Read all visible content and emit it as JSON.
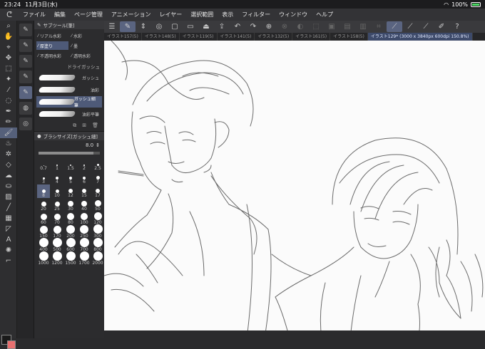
{
  "status": {
    "time": "23:24",
    "date": "11月3日(水)",
    "battery": "100%"
  },
  "menu": {
    "items": [
      "ファイル",
      "編集",
      "ページ管理",
      "アニメーション",
      "レイヤー",
      "選択範囲",
      "表示",
      "フィルター",
      "ウィンドウ",
      "ヘルプ"
    ]
  },
  "tabs": [
    {
      "label": "イラスト157(5)"
    },
    {
      "label": "イラスト148(5)"
    },
    {
      "label": "イラスト119(5)"
    },
    {
      "label": "イラスト141(5)"
    },
    {
      "label": "イラスト132(5)"
    },
    {
      "label": "イラスト161(5)"
    },
    {
      "label": "イラスト158(5)"
    },
    {
      "label": "イラスト129* (3000 x 3840px 600dpi 150.8%)"
    }
  ],
  "subtool": {
    "title": "サブツール[筆]",
    "items": [
      "リアル水彩",
      "水彩",
      "厚塗り",
      "墨",
      "不透明水彩",
      "透明水彩"
    ],
    "group": "ドライガッシュ",
    "brushes": [
      "ガッシュ",
      "油彩",
      "ガッシュ細筆",
      "油彩平筆"
    ]
  },
  "brushsize": {
    "title": "ブラシサイズ[ガッシュ細]",
    "value": "8.0",
    "sizes": [
      "0.7",
      "1",
      "1.5",
      "2",
      "2.5",
      "3",
      "4",
      "5",
      "6",
      "7",
      "8",
      "10",
      "12",
      "15",
      "17",
      "20",
      "25",
      "30",
      "40",
      "50",
      "60",
      "70",
      "80",
      "100",
      "120",
      "150",
      "170",
      "200",
      "250",
      "300",
      "400",
      "500",
      "600",
      "700",
      "800",
      "1000",
      "1200",
      "1500",
      "1700",
      "2000"
    ],
    "selected": "8"
  },
  "colors": {
    "main": "#1a1a1a",
    "sub": "#e87070",
    "accent": "#5a6480"
  }
}
